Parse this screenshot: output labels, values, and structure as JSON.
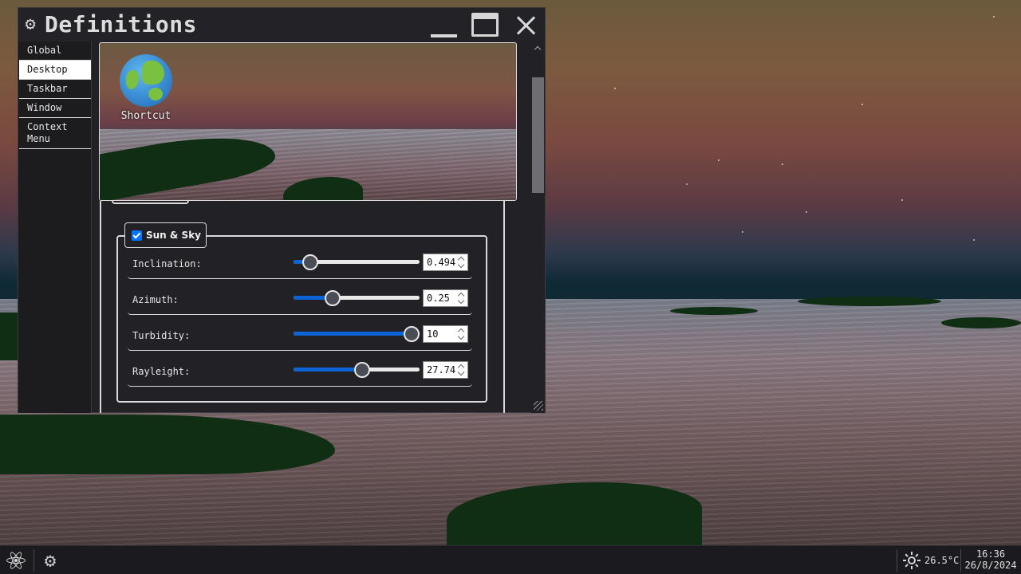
{
  "window": {
    "title": "Definitions"
  },
  "sidebar": {
    "items": [
      {
        "label": "Global"
      },
      {
        "label": "Desktop"
      },
      {
        "label": "Taskbar"
      },
      {
        "label": "Window"
      },
      {
        "label": "Context Menu"
      }
    ],
    "active": "Desktop"
  },
  "preview": {
    "shortcut_label": "Shortcut",
    "shortcut_icon": "globe-icon"
  },
  "sun_sky": {
    "label": "Sun & Sky",
    "enabled": true,
    "fields": [
      {
        "label": "Inclination:",
        "value": "0.494",
        "level": 0.08
      },
      {
        "label": "Azimuth:",
        "value": "0.25",
        "level": 0.28
      },
      {
        "label": "Turbidity:",
        "value": "10",
        "level": 1.0
      },
      {
        "label": "Rayleight:",
        "value": "27.74",
        "level": 0.55
      }
    ]
  },
  "taskbar": {
    "temperature": "26.5°C",
    "time": "16:36",
    "date": "26/8/2024",
    "icons": [
      "react-icon",
      "gear-icon",
      "sun-icon"
    ]
  },
  "colors": {
    "accent": "#0b63d6",
    "window_bg": "#222226",
    "taskbar_bg": "#1b1b1f"
  }
}
